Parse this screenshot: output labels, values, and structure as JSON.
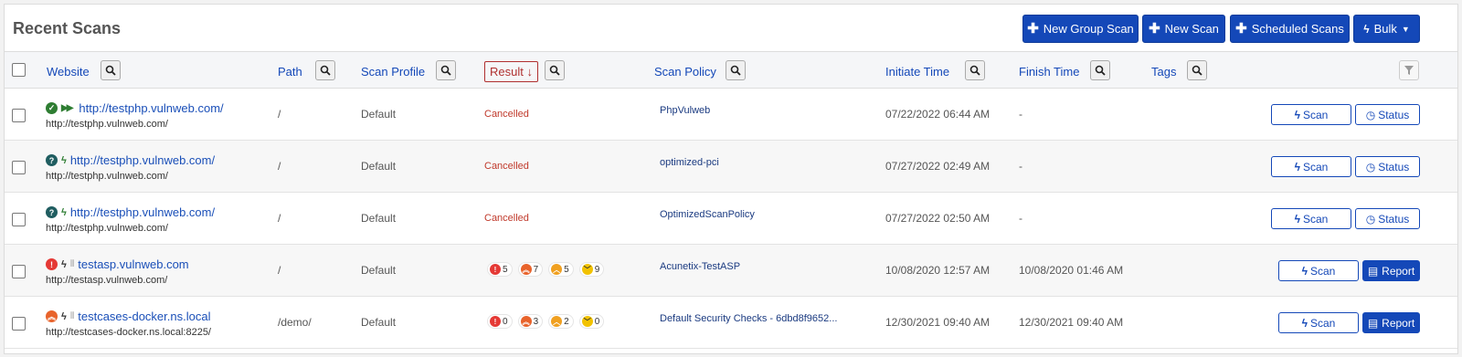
{
  "header": {
    "title": "Recent Scans",
    "buttons": {
      "new_group_scan": "New Group Scan",
      "new_scan": "New Scan",
      "scheduled_scans": "Scheduled Scans",
      "bulk": "Bulk"
    }
  },
  "columns": {
    "website": "Website",
    "path": "Path",
    "scan_profile": "Scan Profile",
    "result": "Result",
    "scan_policy": "Scan Policy",
    "initiate_time": "Initiate Time",
    "finish_time": "Finish Time",
    "tags": "Tags"
  },
  "colors": {
    "primary": "#1448b8",
    "cancelled": "#c0392b",
    "ok_green": "#2e7d32",
    "unknown_teal": "#1f5d60",
    "critical": "#e53935",
    "high": "#e8632b",
    "medium": "#f0a020",
    "low": "#f2c200"
  },
  "rows": [
    {
      "status_icon": "check-circle-icon",
      "mode_icon": "fast-forward-icon",
      "website": "http://testphp.vulnweb.com/",
      "website_sub": "http://testphp.vulnweb.com/",
      "path": "/",
      "scan_profile": "Default",
      "result": "Cancelled",
      "severities": null,
      "scan_policy": "PhpVulweb",
      "initiate_time": "07/22/2022 06:44 AM",
      "finish_time": "-",
      "action1": "Scan",
      "action2": "Status"
    },
    {
      "status_icon": "question-circle-icon",
      "mode_icon": "bolt-icon",
      "website": "http://testphp.vulnweb.com/",
      "website_sub": "http://testphp.vulnweb.com/",
      "path": "/",
      "scan_profile": "Default",
      "result": "Cancelled",
      "severities": null,
      "scan_policy": "optimized-pci",
      "initiate_time": "07/27/2022 02:49 AM",
      "finish_time": "-",
      "action1": "Scan",
      "action2": "Status"
    },
    {
      "status_icon": "question-circle-icon",
      "mode_icon": "bolt-icon",
      "website": "http://testphp.vulnweb.com/",
      "website_sub": "http://testphp.vulnweb.com/",
      "path": "/",
      "scan_profile": "Default",
      "result": "Cancelled",
      "severities": null,
      "scan_policy": "OptimizedScanPolicy",
      "initiate_time": "07/27/2022 02:50 AM",
      "finish_time": "-",
      "action1": "Scan",
      "action2": "Status"
    },
    {
      "status_icon": "exclamation-circle-icon",
      "mode_icon": "bolt-icon",
      "website": "testasp.vulnweb.com",
      "website_sub": "http://testasp.vulnweb.com/",
      "path": "/",
      "scan_profile": "Default",
      "result": "",
      "severities": {
        "critical": "5",
        "high": "7",
        "medium": "5",
        "low": "9"
      },
      "scan_policy": "Acunetix-TestASP",
      "initiate_time": "10/08/2020 12:57 AM",
      "finish_time": "10/08/2020 01:46 AM",
      "action1": "Scan",
      "action2": "Report"
    },
    {
      "status_icon": "chevron-up-circle-icon",
      "mode_icon": "bolt-icon",
      "website": "testcases-docker.ns.local",
      "website_sub": "http://testcases-docker.ns.local:8225/",
      "path": "/demo/",
      "scan_profile": "Default",
      "result": "",
      "severities": {
        "critical": "0",
        "high": "3",
        "medium": "2",
        "low": "0"
      },
      "scan_policy": "Default Security Checks - 6dbd8f9652...",
      "initiate_time": "12/30/2021 09:40 AM",
      "finish_time": "12/30/2021 09:40 AM",
      "action1": "Scan",
      "action2": "Report"
    }
  ]
}
